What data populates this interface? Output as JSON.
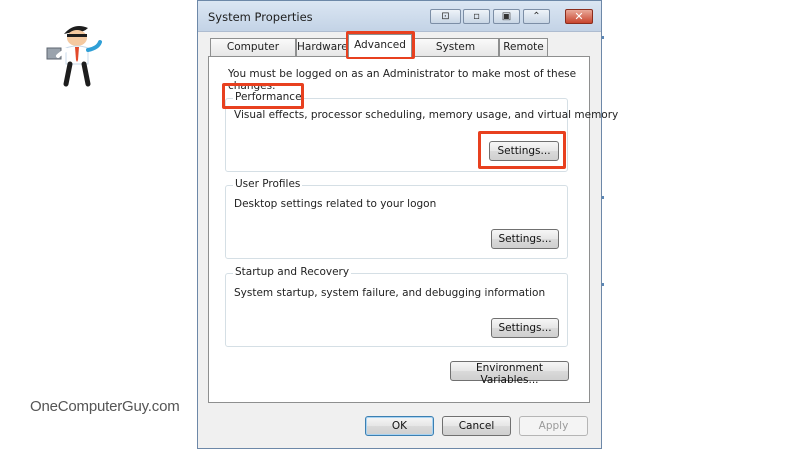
{
  "brand": {
    "watermark": "OneComputerGuy.com"
  },
  "window": {
    "title": "System Properties",
    "controls": [
      "minimize-icon",
      "maximize-icon",
      "close-icon"
    ]
  },
  "tabs": [
    {
      "label": "Computer Name",
      "active": false
    },
    {
      "label": "Hardware",
      "active": false
    },
    {
      "label": "Advanced",
      "active": true
    },
    {
      "label": "System Protection",
      "active": false
    },
    {
      "label": "Remote",
      "active": false
    }
  ],
  "advanced": {
    "admin_note": "You must be logged on as an Administrator to make most of these changes.",
    "performance": {
      "title": "Performance",
      "description": "Visual effects, processor scheduling, memory usage, and virtual memory",
      "button": "Settings..."
    },
    "user_profiles": {
      "title": "User Profiles",
      "description": "Desktop settings related to your logon",
      "button": "Settings..."
    },
    "startup_recovery": {
      "title": "Startup and Recovery",
      "description": "System startup, system failure, and debugging information",
      "button": "Settings..."
    },
    "env_button": "Environment Variables..."
  },
  "footer": {
    "ok": "OK",
    "cancel": "Cancel",
    "apply": "Apply"
  },
  "colors": {
    "highlight": "#e8401f",
    "window_frame": "#6d88a8",
    "panel": "#ffffff"
  }
}
